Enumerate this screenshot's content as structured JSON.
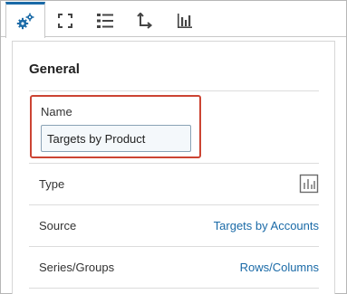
{
  "tabs": [
    {
      "name": "general-properties",
      "icon": "gears-icon",
      "active": true
    },
    {
      "name": "layout",
      "icon": "expand-icon",
      "active": false
    },
    {
      "name": "list",
      "icon": "list-icon",
      "active": false
    },
    {
      "name": "axis",
      "icon": "axis-icon",
      "active": false
    },
    {
      "name": "chart",
      "icon": "bar-chart-icon",
      "active": false
    }
  ],
  "section": {
    "title": "General"
  },
  "name_field": {
    "label": "Name",
    "value": "Targets by Product"
  },
  "properties": [
    {
      "label": "Type",
      "icon": "bar-chart-icon"
    },
    {
      "label": "Source",
      "value": "Targets by Accounts"
    },
    {
      "label": "Series/Groups",
      "value": "Rows/Columns"
    }
  ],
  "colors": {
    "accent": "#1a6aa7",
    "highlight_border": "#cc4433"
  }
}
